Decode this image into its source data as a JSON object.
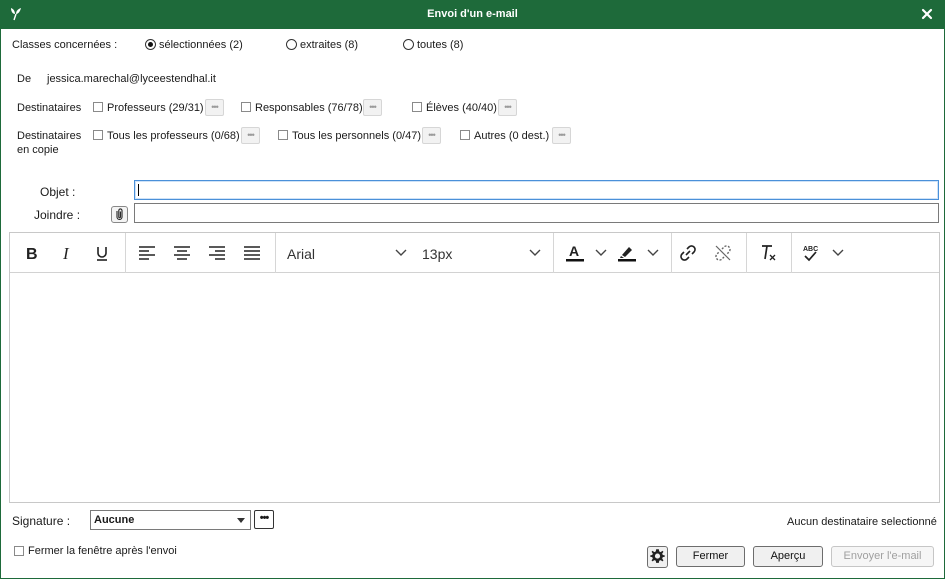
{
  "window": {
    "title": "Envoi d'un e-mail",
    "accent": "#1e6a3a"
  },
  "classes": {
    "label": "Classes concernées :",
    "options": [
      {
        "label": "sélectionnées (2)",
        "selected": true
      },
      {
        "label": "extraites (8)",
        "selected": false
      },
      {
        "label": "toutes (8)",
        "selected": false
      }
    ]
  },
  "from": {
    "label": "De",
    "value": "jessica.marechal@lyceestendhal.it"
  },
  "recipients": {
    "label": "Destinataires",
    "items": [
      {
        "label": "Professeurs (29/31)",
        "checked": false
      },
      {
        "label": "Responsables (76/78)",
        "checked": false
      },
      {
        "label": "Élèves (40/40)",
        "checked": false
      }
    ]
  },
  "cc": {
    "label_line1": "Destinataires",
    "label_line2": "en copie",
    "items": [
      {
        "label": "Tous les professeurs (0/68)",
        "checked": false
      },
      {
        "label": "Tous les personnels (0/47)",
        "checked": false
      },
      {
        "label": "Autres (0 dest.)",
        "checked": false
      }
    ]
  },
  "subject": {
    "label": "Objet :",
    "value": ""
  },
  "attach": {
    "label": "Joindre :",
    "value": ""
  },
  "editor": {
    "font": "Arial",
    "size": "13px",
    "content": ""
  },
  "signature": {
    "label": "Signature :",
    "value": "Aucune"
  },
  "status": "Aucun destinataire selectionné",
  "close_after": {
    "label": "Fermer la fenêtre après l'envoi",
    "checked": false
  },
  "buttons": {
    "close": "Fermer",
    "preview": "Aperçu",
    "send": "Envoyer l'e-mail"
  }
}
